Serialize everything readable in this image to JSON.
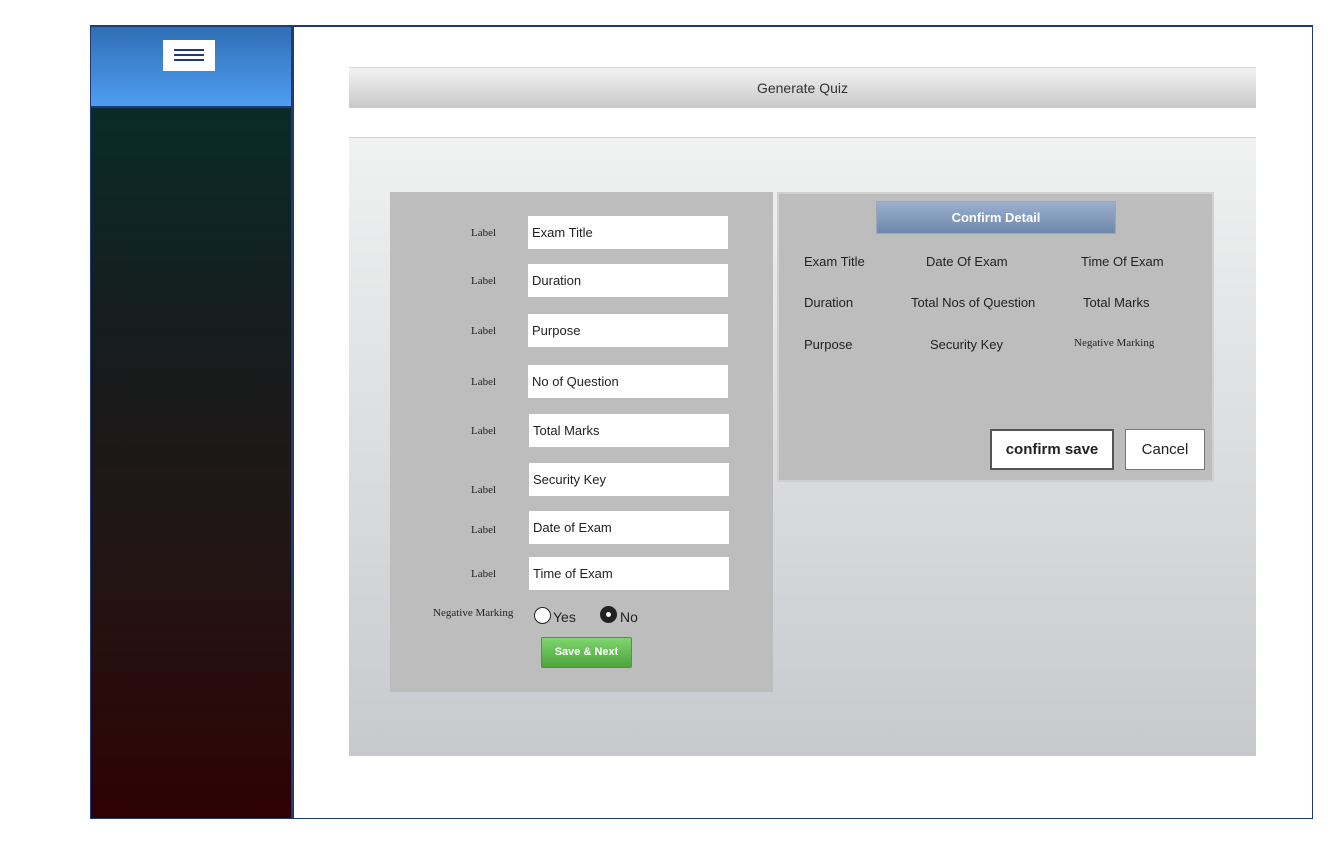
{
  "sidebar": {
    "menu_icon": "hamburger-menu-icon"
  },
  "header": {
    "title": "Generate Quiz"
  },
  "form": {
    "fields": [
      {
        "label": "Label",
        "placeholder": "Exam Title"
      },
      {
        "label": "Label",
        "placeholder": "Duration"
      },
      {
        "label": "Label",
        "placeholder": "Purpose"
      },
      {
        "label": "Label",
        "placeholder": "No of Question"
      },
      {
        "label": "Label",
        "placeholder": "Total Marks"
      },
      {
        "label": "Label",
        "placeholder": "Security Key"
      },
      {
        "label": "Label",
        "placeholder": "Date of Exam"
      },
      {
        "label": "Label",
        "placeholder": "Time of Exam"
      }
    ],
    "negative_marking": {
      "label": "Negative Marking",
      "options": [
        "Yes",
        "No"
      ],
      "selected": "No"
    },
    "save_label": "Save & Next"
  },
  "confirm": {
    "title": "Confirm Detail",
    "rows": [
      [
        "Exam Title",
        "Date Of Exam",
        "Time Of Exam"
      ],
      [
        "Duration",
        "Total Nos of Question",
        "Total Marks"
      ],
      [
        "Purpose",
        "Security Key",
        "Negative Marking"
      ]
    ],
    "confirm_label": "confirm save",
    "cancel_label": "Cancel"
  },
  "colors": {
    "frame_border": "#1f3a7a",
    "sidebar_header": "#4f9df2",
    "save_button": "#5cb84a",
    "confirm_header": "#7f95b8"
  }
}
